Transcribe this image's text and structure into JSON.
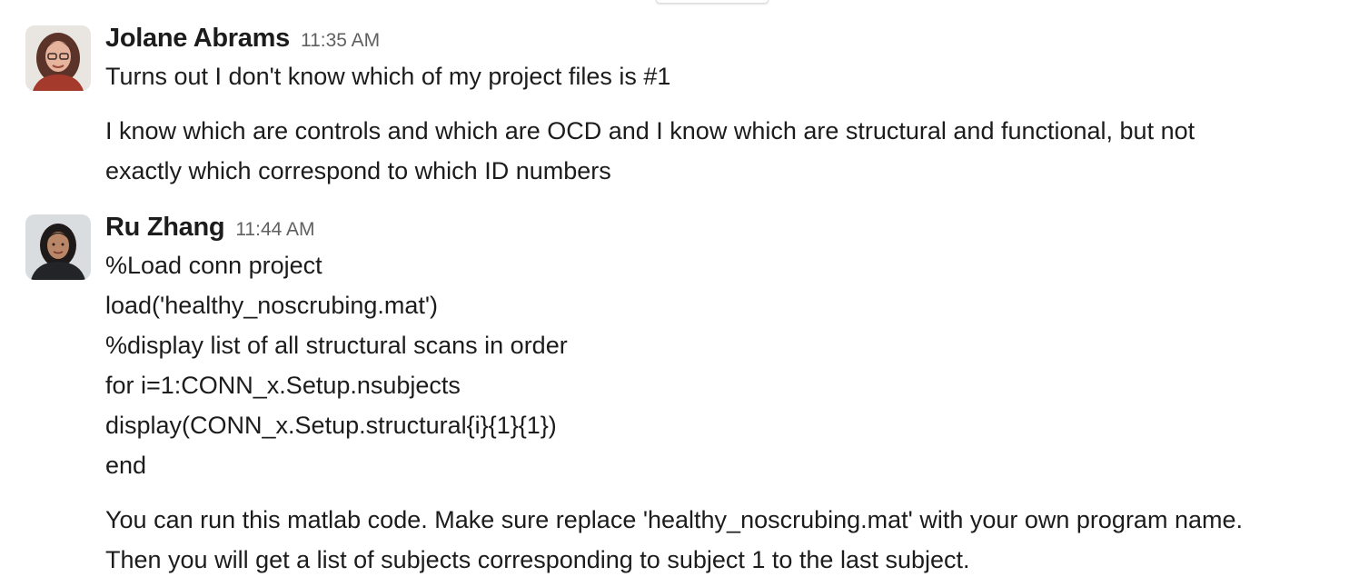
{
  "messages": [
    {
      "sender": "Jolane Abrams",
      "time": "11:35 AM",
      "paragraphs": [
        [
          "Turns out I don't know which of my project files is #1"
        ],
        [
          "I know which are controls and which are OCD and I know which are structural and functional, but not",
          "exactly which correspond to which ID numbers"
        ]
      ]
    },
    {
      "sender": "Ru Zhang",
      "time": "11:44 AM",
      "paragraphs": [
        [
          "%Load conn project",
          "load('healthy_noscrubing.mat')",
          "%display list of all structural scans in order",
          "for i=1:CONN_x.Setup.nsubjects",
          "display(CONN_x.Setup.structural{i}{1}{1})",
          "end"
        ],
        [
          "You can run this matlab code. Make sure replace 'healthy_noscrubing.mat' with your own program name.",
          "Then you will get a list of subjects corresponding to subject 1 to the last subject."
        ]
      ]
    }
  ]
}
